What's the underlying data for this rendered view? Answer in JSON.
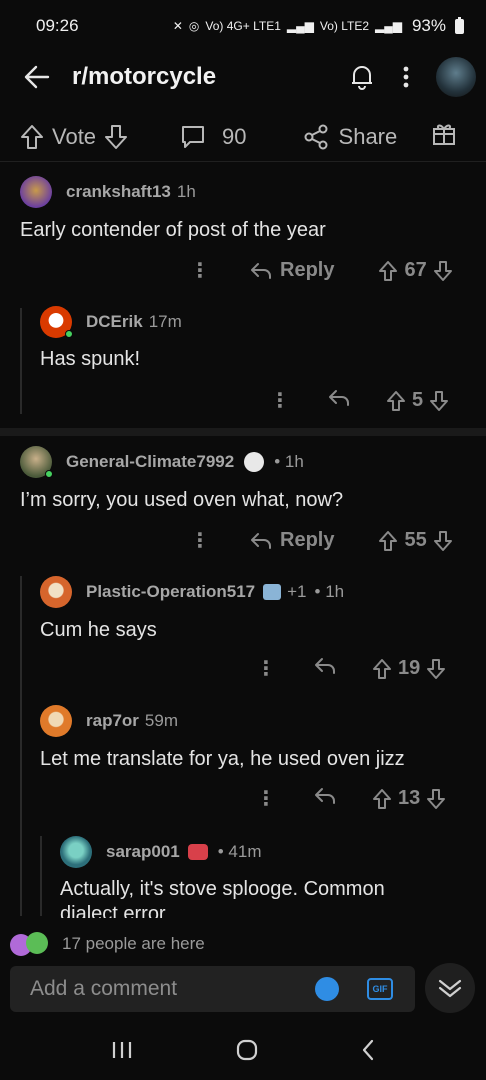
{
  "status": {
    "time": "09:26",
    "network1": "Vo) 4G+ LTE1",
    "network2": "Vo) LTE2",
    "battery": "93%"
  },
  "header": {
    "title": "r/motorcycle"
  },
  "actionbar": {
    "vote_label": "Vote",
    "comment_count": "90",
    "share_label": "Share"
  },
  "comments": [
    {
      "user": "crankshaft13",
      "age": "1h",
      "text": "Early contender of post of the year",
      "reply_label": "Reply",
      "votes": "67"
    },
    {
      "user": "DCErik",
      "age": "17m",
      "text": "Has spunk!",
      "votes": "5"
    },
    {
      "user": "General-Climate7992",
      "age": "• 1h",
      "text": "I’m sorry, you used oven what, now?",
      "reply_label": "Reply",
      "votes": "55"
    },
    {
      "user": "Plastic-Operation517",
      "flair": "+1",
      "age": "• 1h",
      "text": "Cum he says",
      "votes": "19"
    },
    {
      "user": "rap7or",
      "age": "59m",
      "text": "Let me translate for ya, he used oven jizz",
      "votes": "13"
    },
    {
      "user": "sarap001",
      "age": "• 41m",
      "text": "Actually, it's stove splooge. Common",
      "text2": "dialect error"
    }
  ],
  "presence": {
    "text": "17 people are here"
  },
  "composer": {
    "placeholder": "Add a comment",
    "gif_label": "GIF"
  },
  "colors": {
    "accent": "#2f8de4",
    "online": "#46d160",
    "background": "#0b0b0b"
  }
}
